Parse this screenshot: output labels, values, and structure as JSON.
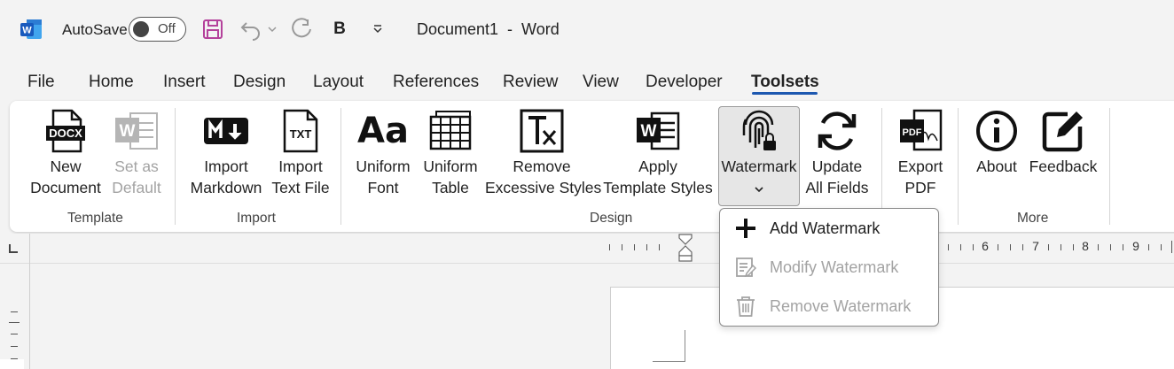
{
  "titlebar": {
    "autosave_label": "AutoSave",
    "autosave_state": "Off",
    "document_title": "Document1  -  Word",
    "quick_access": [
      "save-icon",
      "undo-icon",
      "redo-icon",
      "bold-icon",
      "customize-icon"
    ],
    "bold_glyph": "B"
  },
  "tabs": [
    "File",
    "Home",
    "Insert",
    "Design",
    "Layout",
    "References",
    "Review",
    "View",
    "Developer",
    "Toolsets"
  ],
  "active_tab": "Toolsets",
  "ribbon": {
    "template": {
      "group": "Template",
      "new_document": [
        "New",
        "Document"
      ],
      "set_as_default": [
        "Set as",
        "Default"
      ]
    },
    "import": {
      "group": "Import",
      "import_markdown": [
        "Import",
        "Markdown"
      ],
      "import_text": [
        "Import",
        "Text File"
      ]
    },
    "design": {
      "group": "Design",
      "uniform_font": [
        "Uniform",
        "Font"
      ],
      "uniform_table": [
        "Uniform",
        "Table"
      ],
      "remove_styles": [
        "Remove",
        "Excessive Styles"
      ],
      "apply_template": [
        "Apply",
        "Template Styles"
      ],
      "watermark": [
        "Watermark",
        ""
      ],
      "update_fields": [
        "Update",
        "All Fields"
      ],
      "export_pdf": [
        "Export",
        "PDF"
      ]
    },
    "more": {
      "group": "More",
      "about": [
        "About",
        ""
      ],
      "feedback": [
        "Feedback",
        ""
      ]
    },
    "icon_text": {
      "docx": "DOCX",
      "word_w": "W",
      "txt": "TXT",
      "aa": "Aa",
      "pdf": "PDF",
      "info": "i"
    }
  },
  "watermark_menu": {
    "add": "Add Watermark",
    "modify": "Modify Watermark",
    "remove": "Remove Watermark"
  },
  "ruler_numbers": [
    "6",
    "7",
    "8",
    "9"
  ],
  "colors": {
    "accent": "#1d58b0",
    "word_blue": "#185abd",
    "save_magenta": "#b4419b",
    "disabled": "#a3a3a3"
  }
}
